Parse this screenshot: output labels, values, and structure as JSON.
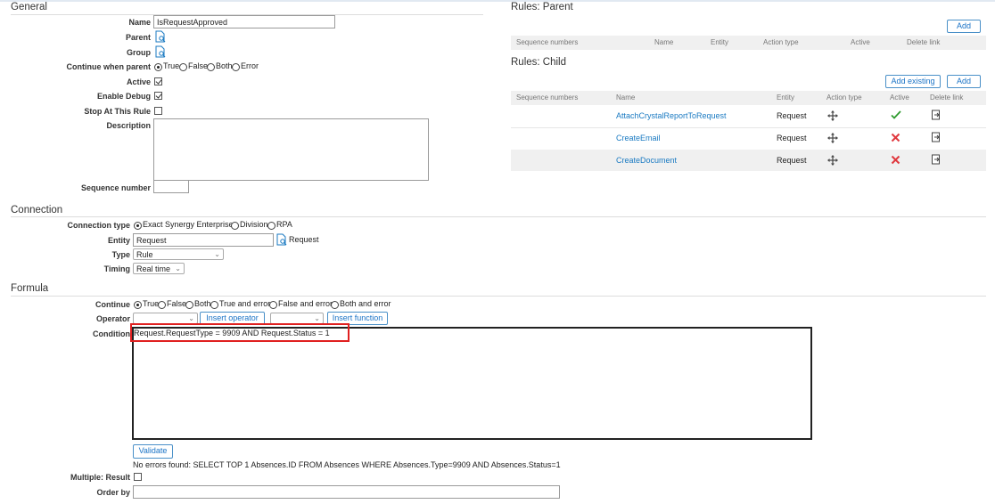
{
  "general": {
    "title": "General",
    "name_label": "Name",
    "name_value": "IsRequestApproved",
    "parent_label": "Parent",
    "group_label": "Group",
    "continue_label": "Continue when parent",
    "continue_options": [
      "True",
      "False",
      "Both",
      "Error"
    ],
    "active_label": "Active",
    "debug_label": "Enable Debug",
    "stop_label": "Stop At This Rule",
    "description_label": "Description",
    "sequence_label": "Sequence number"
  },
  "rules_parent": {
    "title": "Rules: Parent",
    "add_label": "Add",
    "columns": [
      "Sequence numbers",
      "Name",
      "Entity",
      "Action type",
      "Active",
      "Delete link"
    ]
  },
  "rules_child": {
    "title": "Rules: Child",
    "add_existing_label": "Add existing",
    "add_label": "Add",
    "columns": [
      "Sequence numbers",
      "Name",
      "Entity",
      "Action type",
      "Active",
      "Delete link"
    ],
    "rows": [
      {
        "name": "AttachCrystalReportToRequest",
        "entity": "Request",
        "active": true
      },
      {
        "name": "CreateEmail",
        "entity": "Request",
        "active": false
      },
      {
        "name": "CreateDocument",
        "entity": "Request",
        "active": false
      }
    ]
  },
  "connection": {
    "title": "Connection",
    "type_label": "Connection type",
    "type_options": [
      "Exact Synergy Enterprise",
      "Division",
      "RPA"
    ],
    "entity_label": "Entity",
    "entity_value": "Request",
    "entity_link": "Request",
    "type2_label": "Type",
    "type2_value": "Rule",
    "timing_label": "Timing",
    "timing_value": "Real time"
  },
  "formula": {
    "title": "Formula",
    "continue_label": "Continue",
    "continue_options": [
      "True",
      "False",
      "Both",
      "True and error",
      "False and error",
      "Both and error"
    ],
    "operator_label": "Operator",
    "insert_operator_label": "Insert operator",
    "insert_function_label": "Insert function",
    "condition_label": "Condition",
    "condition_value": "Request.RequestType = 9909  AND Request.Status = 1",
    "validate_label": "Validate",
    "validation_message": "No errors found: SELECT TOP 1 Absences.ID FROM Absences WHERE Absences.Type=9909 AND Absences.Status=1",
    "multiple_result_label": "Multiple: Result",
    "order_by_label": "Order by"
  },
  "colors": {
    "link": "#1a7ac2",
    "active_check": "#2e9b2e",
    "inactive_x": "#e0383e",
    "highlight": "#e02020"
  }
}
